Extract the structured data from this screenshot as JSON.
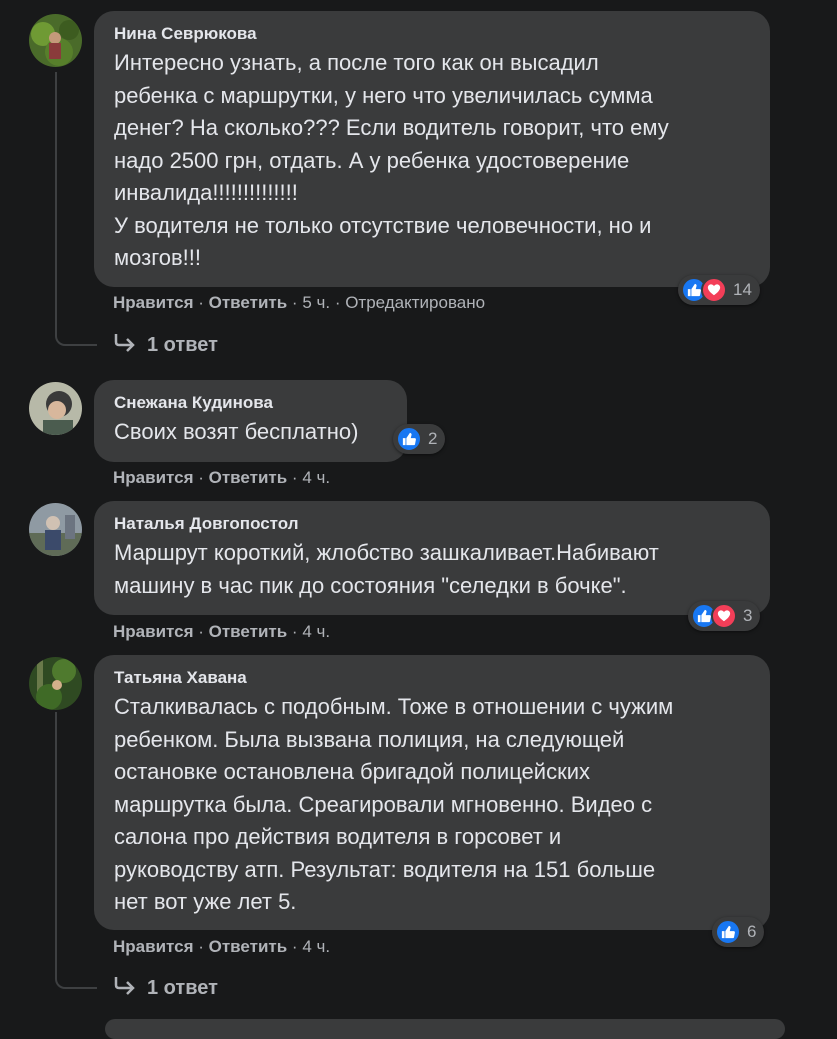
{
  "comments": [
    {
      "author": "Нина Севрюкова",
      "text": "Интересно узнать, а после того как он высадил\nребенка с маршрутки, у него что увеличилась сумма\nденег? На сколько??? Если водитель говорит, что ему\nнадо 2500 грн, отдать. А у ребенка удостоверение\nинвалида!!!!!!!!!!!!!!\nУ водителя не только отсутствие человечности, но и\nмозгов!!!",
      "like": "Нравится",
      "reply": "Ответить",
      "time": "5 ч.",
      "edited": "Отредактировано",
      "reaction_count": "14",
      "replies_label": "1 ответ"
    },
    {
      "author": "Снежана Кудинова",
      "text": "Своих возят бесплатно)",
      "like": "Нравится",
      "reply": "Ответить",
      "time": "4 ч.",
      "reaction_count": "2"
    },
    {
      "author": "Наталья Довгопостол",
      "text": "Маршрут короткий, жлобство зашкаливает.Набивают\nмашину в час пик до состояния \"селедки в бочке\".",
      "like": "Нравится",
      "reply": "Ответить",
      "time": "4 ч.",
      "reaction_count": "3"
    },
    {
      "author": "Татьяна Хавана",
      "text": "Сталкивалась с подобным. Тоже в отношении с чужим\nребенком. Была вызвана полиция, на следующей\nостановке остановлена бригадой полицейских\nмаршрутка была. Среагировали мгновенно. Видео с\nсалона про действия водителя в горсовет и\nруководству атп. Результат: водителя на 151 больше\nнет вот уже лет 5.",
      "like": "Нравится",
      "reply": "Ответить",
      "time": "4 ч.",
      "reaction_count": "6",
      "replies_label": "1 ответ"
    }
  ],
  "separator": "·",
  "colors": {
    "background": "#18191a",
    "bubble": "#3a3b3c",
    "text": "#e4e6eb",
    "secondary": "#b0b3b8",
    "like": "#1877f2",
    "love": "#f33e58"
  },
  "icons": [
    "like-icon",
    "love-icon",
    "reply-arrow-icon"
  ]
}
